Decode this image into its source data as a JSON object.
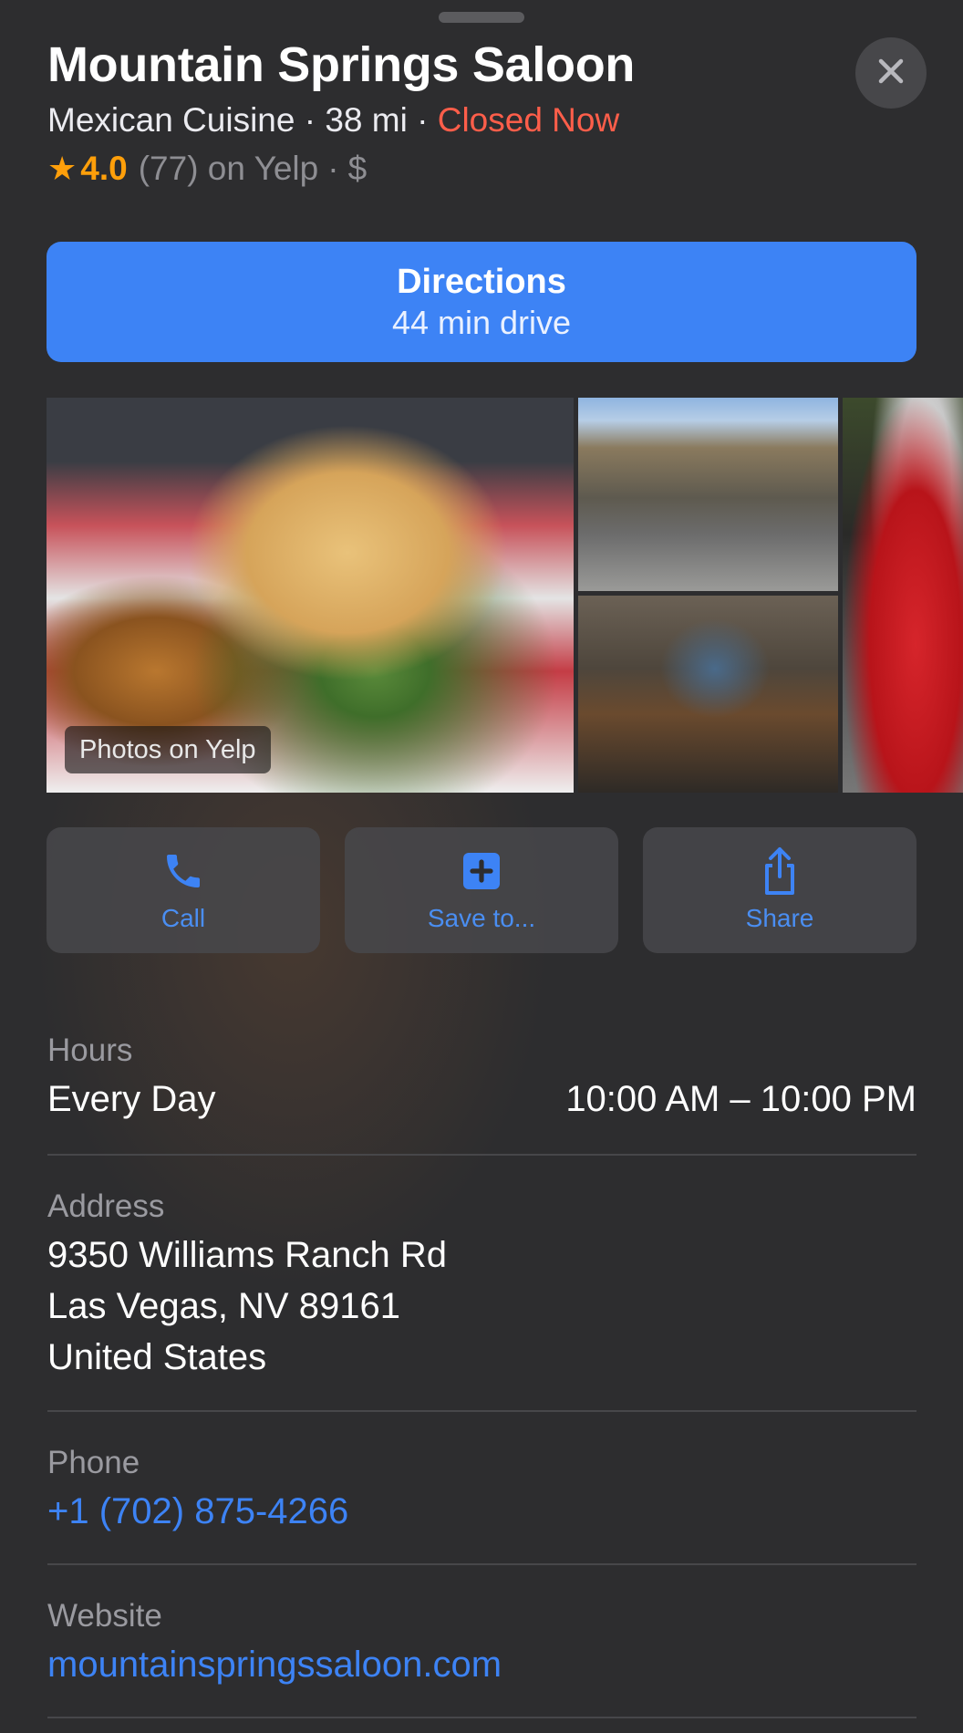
{
  "place": {
    "name": "Mountain Springs Saloon",
    "cuisine": "Mexican Cuisine",
    "distance": "38 mi",
    "separator": "·",
    "status": "Closed Now",
    "rating_value": "4.0",
    "rating_count_source": "(77) on Yelp",
    "price": "$"
  },
  "directions": {
    "label": "Directions",
    "drive_time": "44 min drive"
  },
  "photos": {
    "tag_label": "Photos on Yelp"
  },
  "actions": [
    {
      "label": "Call",
      "icon": "phone-icon"
    },
    {
      "label": "Save to...",
      "icon": "plus-square-icon"
    },
    {
      "label": "Share",
      "icon": "share-icon"
    }
  ],
  "hours": {
    "label": "Hours",
    "day": "Every Day",
    "time": "10:00 AM – 10:00 PM"
  },
  "address": {
    "label": "Address",
    "line1": "9350 Williams Ranch Rd",
    "line2": "Las Vegas, NV 89161",
    "line3": "United States"
  },
  "phone": {
    "label": "Phone",
    "value": "+1 (702) 875-4266"
  },
  "website": {
    "label": "Website",
    "value": "mountainspringssaloon.com"
  },
  "colors": {
    "accent": "#3d83f5",
    "closed": "#ff5e4a",
    "star": "#ff9f0a",
    "background": "#2d2d2f"
  }
}
